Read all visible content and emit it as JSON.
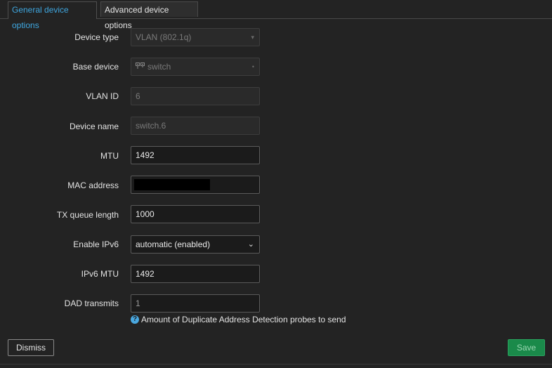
{
  "tabs": [
    {
      "label": "General device options",
      "active": true
    },
    {
      "label": "Advanced device options",
      "active": false
    }
  ],
  "form": {
    "device_type": {
      "label": "Device type",
      "value": "VLAN (802.1q)"
    },
    "base_device": {
      "label": "Base device",
      "value": "switch"
    },
    "vlan_id": {
      "label": "VLAN ID",
      "value": "6"
    },
    "device_name": {
      "label": "Device name",
      "value": "switch.6"
    },
    "mtu": {
      "label": "MTU",
      "value": "1492"
    },
    "mac_address": {
      "label": "MAC address",
      "value": ""
    },
    "tx_queue_length": {
      "label": "TX queue length",
      "value": "1000"
    },
    "enable_ipv6": {
      "label": "Enable IPv6",
      "value": "automatic (enabled)"
    },
    "ipv6_mtu": {
      "label": "IPv6 MTU",
      "value": "1492"
    },
    "dad_transmits": {
      "label": "DAD transmits",
      "value": "1",
      "help": "Amount of Duplicate Address Detection probes to send"
    }
  },
  "buttons": {
    "dismiss": "Dismiss",
    "save": "Save"
  },
  "colors": {
    "background": "#232323",
    "active_tab": "#3fa7e0",
    "save_button": "#1a8a4a",
    "help_icon": "#4aa8e0"
  },
  "icons": {
    "base_device": "network-device-icon",
    "help": "help-icon",
    "dropdown": "chevron-down-icon"
  }
}
